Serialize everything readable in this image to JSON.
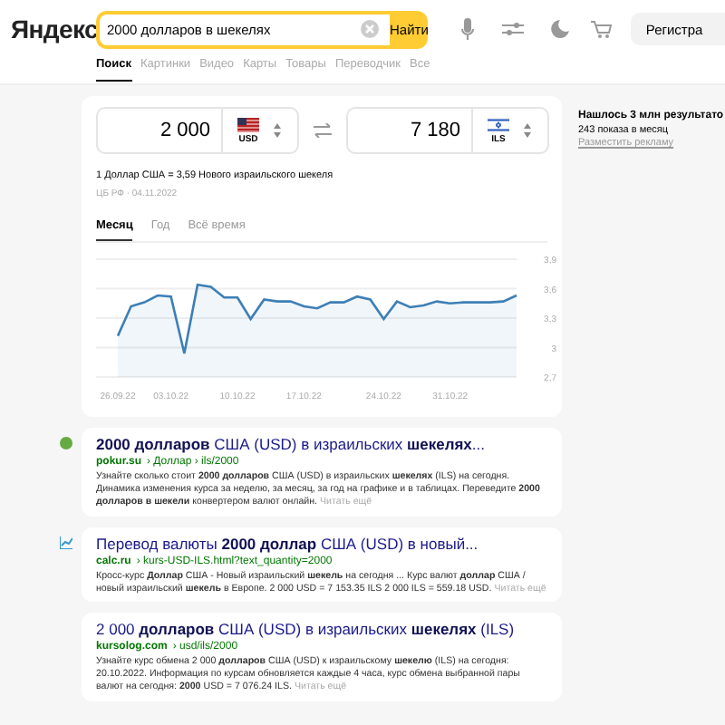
{
  "header": {
    "logo": "Яндекс",
    "search": {
      "value": "2000 долларов в шекелях"
    },
    "search_button": "Найти",
    "register_button": "Регистра"
  },
  "tabs": [
    {
      "label": "Поиск",
      "selected": true
    },
    {
      "label": "Картинки",
      "selected": false
    },
    {
      "label": "Видео",
      "selected": false
    },
    {
      "label": "Карты",
      "selected": false
    },
    {
      "label": "Товары",
      "selected": false
    },
    {
      "label": "Переводчик",
      "selected": false
    },
    {
      "label": "Все",
      "selected": false
    }
  ],
  "converter": {
    "from": {
      "amount": "2 000",
      "currency": "USD"
    },
    "to": {
      "amount": "7 180",
      "currency": "ILS"
    },
    "rate": "1 Доллар США = 3,59 Нового израильского шекеля",
    "source": "ЦБ РФ · 04.11.2022",
    "periods": [
      {
        "label": "Месяц",
        "selected": true
      },
      {
        "label": "Год",
        "selected": false
      },
      {
        "label": "Всё время",
        "selected": false
      }
    ],
    "chart_data": {
      "type": "area",
      "categories": [
        "26.09.22",
        null,
        null,
        null,
        "03.10.22",
        null,
        null,
        null,
        null,
        "10.10.22",
        null,
        null,
        null,
        null,
        "17.10.22",
        null,
        null,
        null,
        null,
        null,
        "24.10.22",
        null,
        null,
        null,
        null,
        "31.10.22",
        null,
        null,
        null,
        null,
        null
      ],
      "series": [
        {
          "color": "#3d7fb6",
          "values": [
            3.12,
            3.42,
            3.46,
            3.53,
            3.52,
            2.94,
            3.64,
            3.62,
            3.51,
            3.51,
            3.29,
            3.49,
            3.47,
            3.47,
            3.42,
            3.4,
            3.46,
            3.46,
            3.52,
            3.49,
            3.29,
            3.47,
            3.41,
            3.43,
            3.47,
            3.45,
            3.46,
            3.46,
            3.46,
            3.47,
            3.53
          ]
        }
      ],
      "ylim": [
        2.7,
        3.9
      ],
      "grid": true,
      "yticks": [
        {
          "value": 2.7,
          "label": "2,7"
        },
        {
          "value": 3,
          "label": "3"
        },
        {
          "value": 3.3,
          "label": "3,3"
        },
        {
          "value": 3.6,
          "label": "3,6"
        },
        {
          "value": 3.9,
          "label": "3,9"
        }
      ]
    }
  },
  "sidebar": {
    "found": "Нашлось 3 млн результато",
    "shows": "243 показа в месяц",
    "ad_link": "Разместить рекламу"
  },
  "results": [
    {
      "kind": "dot",
      "title": "**2000 долларов** США (USD) в израильских **шекелях**...",
      "domain": "pokur.su",
      "path": "› Доллар › ils/2000",
      "snippet": "Узнайте сколько стоит **2000 долларов** США (USD) в израильских **шекелях** (ILS) на сегодня. Динамика изменения курса за неделю, за месяц, за год на графике и в таблицах. Переведите **2000 долларов в шекели** конвертером валют онлайн.",
      "more": "Читать ещё"
    },
    {
      "kind": "chart",
      "title": "Перевод валюты **2000 доллар** США (USD) в новый...",
      "domain": "calc.ru",
      "path": "› kurs-USD-ILS.html?text_quantity=2000",
      "snippet": "Кросс-курс **Доллар** США - Новый израильский **шекель** на сегодня ... Курс валют **доллар** США / новый израильский **шекель** в Европе. 2 000 USD = 7 153.35 ILS 2 000 ILS = 559.18 USD.",
      "more": "Читать ещё"
    },
    {
      "kind": "plain",
      "title": "2 000 **долларов** США (USD) в израильских **шекелях** (ILS)",
      "domain": "kursolog.com",
      "path": "› usd/ils/2000",
      "snippet": "Узнайте курс обмена 2 000 **долларов** США (USD) к израильскому **шекелю** (ILS) на сегодня: 20.10.2022. Информация по курсам обновляется каждые 4 часа, курс обмена выбранной пары валют на сегодня: **2000** USD = 7 076.24 ILS.",
      "more": "Читать ещё"
    }
  ]
}
